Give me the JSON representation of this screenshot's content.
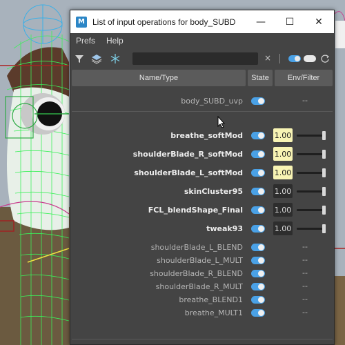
{
  "window": {
    "title": "List of input operations for body_SUBD",
    "logo_letter": "M",
    "minimize_glyph": "—",
    "maximize_glyph": "☐",
    "close_glyph": "✕"
  },
  "menu": [
    "Prefs",
    "Help"
  ],
  "toolbar": {
    "search_value": "",
    "clear_glyph": "×"
  },
  "columns": {
    "name": "Name/Type",
    "state": "State",
    "env": "Env/Filter"
  },
  "rows": [
    {
      "name": "body_SUBD_uvp",
      "weight": "dim",
      "env": "--",
      "state": true
    },
    {
      "name": "breathe_softMod",
      "weight": "bold",
      "env": "1.00",
      "env_style": "hi",
      "slider": 1.0,
      "state": true
    },
    {
      "name": "shoulderBlade_R_softMod",
      "weight": "bold",
      "env": "1.00",
      "env_style": "hi",
      "slider": 1.0,
      "state": true
    },
    {
      "name": "shoulderBlade_L_softMod",
      "weight": "bold",
      "env": "1.00",
      "env_style": "hi",
      "slider": 1.0,
      "state": true
    },
    {
      "name": "skinCluster95",
      "weight": "bold",
      "env": "1.00",
      "env_style": "lo",
      "slider": 1.0,
      "state": true
    },
    {
      "name": "FCL_blendShape_Final",
      "weight": "bold",
      "env": "1.00",
      "env_style": "lo",
      "slider": 1.0,
      "state": true
    },
    {
      "name": "tweak93",
      "weight": "bold",
      "env": "1.00",
      "env_style": "lo",
      "slider": 1.0,
      "state": true
    },
    {
      "name": "shoulderBlade_L_BLEND",
      "weight": "dim",
      "env": "--",
      "state": true
    },
    {
      "name": "shoulderBlade_L_MULT",
      "weight": "dim",
      "env": "--",
      "state": true
    },
    {
      "name": "shoulderBlade_R_BLEND",
      "weight": "dim",
      "env": "--",
      "state": true
    },
    {
      "name": "shoulderBlade_R_MULT",
      "weight": "dim",
      "env": "--",
      "state": true
    },
    {
      "name": "breathe_BLEND1",
      "weight": "dim",
      "env": "--",
      "state": true
    },
    {
      "name": "breathe_MULT1",
      "weight": "dim",
      "env": "--",
      "state": true
    }
  ],
  "colors": {
    "accent_toggle": "#4aa1e6",
    "highlight_value": "#f8f4b4",
    "panel_bg": "#444444"
  }
}
